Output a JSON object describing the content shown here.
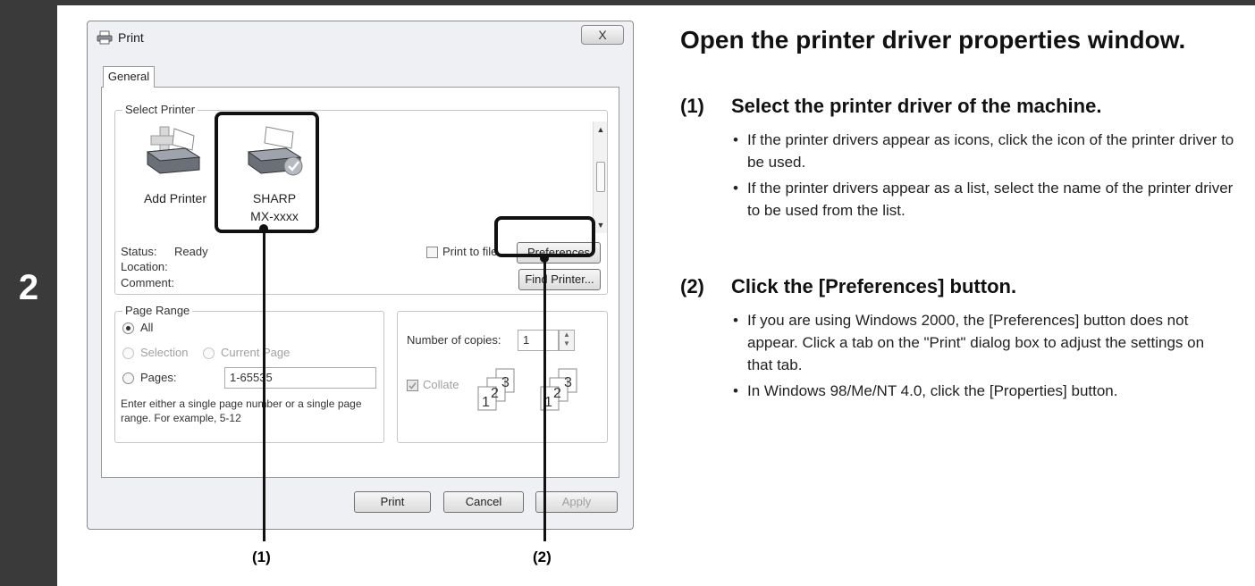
{
  "step_number": "2",
  "dialog": {
    "title": "Print",
    "close_symbol": "X",
    "tab_general": "General",
    "select_printer_label": "Select Printer",
    "printers": [
      {
        "name": "Add Printer",
        "icon": "add-printer-icon"
      },
      {
        "name": "SHARP\nMX-xxxx",
        "icon": "printer-icon"
      }
    ],
    "status_label": "Status:",
    "status_value": "Ready",
    "location_label": "Location:",
    "comment_label": "Comment:",
    "print_to_file_label": "Print to file",
    "preferences_label": "Preferences",
    "find_printer_label": "Find Printer...",
    "page_range_label": "Page Range",
    "all_label": "All",
    "selection_label": "Selection",
    "current_page_label": "Current Page",
    "pages_label": "Pages:",
    "pages_value": "1-65535",
    "page_range_hint": "Enter either a single page number or a single page range.  For example, 5-12",
    "copies_label": "Number of copies:",
    "copies_value": "1",
    "collate_label": "Collate",
    "print_button": "Print",
    "cancel_button": "Cancel",
    "apply_button": "Apply"
  },
  "callouts": {
    "one": "(1)",
    "two": "(2)"
  },
  "instructions": {
    "heading": "Open the printer driver properties window.",
    "step1_num": "(1)",
    "step1_text": "Select the printer driver of the machine.",
    "step1_bullets": [
      "If the printer drivers appear as icons, click the icon of the printer driver to be used.",
      "If the printer drivers appear as a list, select the name of the printer driver to be used from the list."
    ],
    "step2_num": "(2)",
    "step2_text": "Click the [Preferences] button.",
    "step2_bullets": [
      "If you are using Windows 2000, the [Preferences] button does not appear. Click a tab on the \"Print\" dialog box to adjust the settings on that tab.",
      "In Windows 98/Me/NT 4.0, click the [Properties] button."
    ]
  },
  "colors": {
    "sidebar": "#3a3a3a",
    "dialog_bg": "#eef0f3"
  }
}
